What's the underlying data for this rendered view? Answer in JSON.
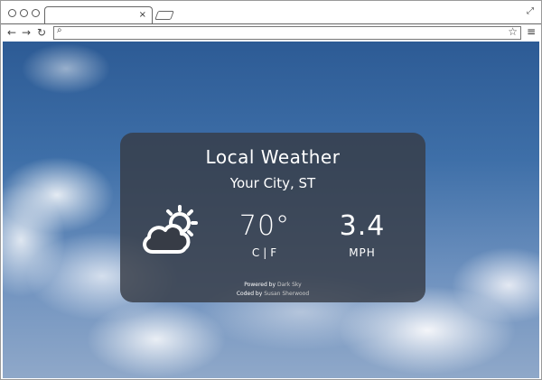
{
  "browser": {
    "tab_close": "×",
    "address_value": "",
    "icons": {
      "back": "arrow-left-icon",
      "forward": "arrow-right-icon",
      "reload": "reload-icon",
      "search": "search-icon",
      "star": "star-icon",
      "menu": "menu-icon",
      "expand": "expand-icon"
    }
  },
  "weather": {
    "title": "Local Weather",
    "city": "Your City, ST",
    "temperature": "70°",
    "unit_c": "C",
    "unit_sep": "|",
    "unit_f": "F",
    "wind_speed": "3.4",
    "wind_unit": "MPH",
    "condition_icon": "partly-cloudy-icon",
    "powered_prefix": "Powered by",
    "powered_link": "Dark Sky",
    "coded_prefix": "Coded by",
    "coded_link": "Susan Sherwood"
  },
  "colors": {
    "card_background": "#373c46",
    "text": "#ffffff",
    "sky": "#3e6fa8"
  }
}
